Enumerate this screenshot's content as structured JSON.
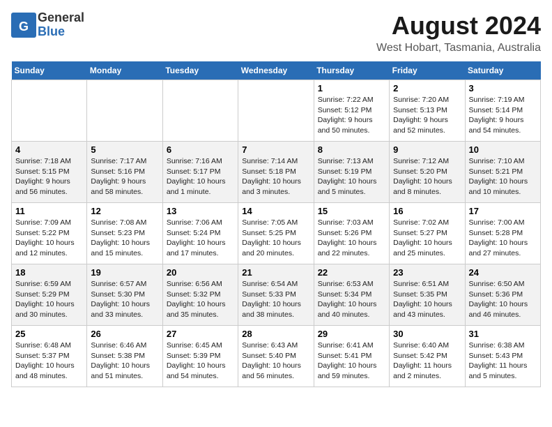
{
  "header": {
    "logo_general": "General",
    "logo_blue": "Blue",
    "month_title": "August 2024",
    "location": "West Hobart, Tasmania, Australia"
  },
  "weekdays": [
    "Sunday",
    "Monday",
    "Tuesday",
    "Wednesday",
    "Thursday",
    "Friday",
    "Saturday"
  ],
  "weeks": [
    [
      {
        "day": "",
        "content": ""
      },
      {
        "day": "",
        "content": ""
      },
      {
        "day": "",
        "content": ""
      },
      {
        "day": "",
        "content": ""
      },
      {
        "day": "1",
        "content": "Sunrise: 7:22 AM\nSunset: 5:12 PM\nDaylight: 9 hours\nand 50 minutes."
      },
      {
        "day": "2",
        "content": "Sunrise: 7:20 AM\nSunset: 5:13 PM\nDaylight: 9 hours\nand 52 minutes."
      },
      {
        "day": "3",
        "content": "Sunrise: 7:19 AM\nSunset: 5:14 PM\nDaylight: 9 hours\nand 54 minutes."
      }
    ],
    [
      {
        "day": "4",
        "content": "Sunrise: 7:18 AM\nSunset: 5:15 PM\nDaylight: 9 hours\nand 56 minutes."
      },
      {
        "day": "5",
        "content": "Sunrise: 7:17 AM\nSunset: 5:16 PM\nDaylight: 9 hours\nand 58 minutes."
      },
      {
        "day": "6",
        "content": "Sunrise: 7:16 AM\nSunset: 5:17 PM\nDaylight: 10 hours\nand 1 minute."
      },
      {
        "day": "7",
        "content": "Sunrise: 7:14 AM\nSunset: 5:18 PM\nDaylight: 10 hours\nand 3 minutes."
      },
      {
        "day": "8",
        "content": "Sunrise: 7:13 AM\nSunset: 5:19 PM\nDaylight: 10 hours\nand 5 minutes."
      },
      {
        "day": "9",
        "content": "Sunrise: 7:12 AM\nSunset: 5:20 PM\nDaylight: 10 hours\nand 8 minutes."
      },
      {
        "day": "10",
        "content": "Sunrise: 7:10 AM\nSunset: 5:21 PM\nDaylight: 10 hours\nand 10 minutes."
      }
    ],
    [
      {
        "day": "11",
        "content": "Sunrise: 7:09 AM\nSunset: 5:22 PM\nDaylight: 10 hours\nand 12 minutes."
      },
      {
        "day": "12",
        "content": "Sunrise: 7:08 AM\nSunset: 5:23 PM\nDaylight: 10 hours\nand 15 minutes."
      },
      {
        "day": "13",
        "content": "Sunrise: 7:06 AM\nSunset: 5:24 PM\nDaylight: 10 hours\nand 17 minutes."
      },
      {
        "day": "14",
        "content": "Sunrise: 7:05 AM\nSunset: 5:25 PM\nDaylight: 10 hours\nand 20 minutes."
      },
      {
        "day": "15",
        "content": "Sunrise: 7:03 AM\nSunset: 5:26 PM\nDaylight: 10 hours\nand 22 minutes."
      },
      {
        "day": "16",
        "content": "Sunrise: 7:02 AM\nSunset: 5:27 PM\nDaylight: 10 hours\nand 25 minutes."
      },
      {
        "day": "17",
        "content": "Sunrise: 7:00 AM\nSunset: 5:28 PM\nDaylight: 10 hours\nand 27 minutes."
      }
    ],
    [
      {
        "day": "18",
        "content": "Sunrise: 6:59 AM\nSunset: 5:29 PM\nDaylight: 10 hours\nand 30 minutes."
      },
      {
        "day": "19",
        "content": "Sunrise: 6:57 AM\nSunset: 5:30 PM\nDaylight: 10 hours\nand 33 minutes."
      },
      {
        "day": "20",
        "content": "Sunrise: 6:56 AM\nSunset: 5:32 PM\nDaylight: 10 hours\nand 35 minutes."
      },
      {
        "day": "21",
        "content": "Sunrise: 6:54 AM\nSunset: 5:33 PM\nDaylight: 10 hours\nand 38 minutes."
      },
      {
        "day": "22",
        "content": "Sunrise: 6:53 AM\nSunset: 5:34 PM\nDaylight: 10 hours\nand 40 minutes."
      },
      {
        "day": "23",
        "content": "Sunrise: 6:51 AM\nSunset: 5:35 PM\nDaylight: 10 hours\nand 43 minutes."
      },
      {
        "day": "24",
        "content": "Sunrise: 6:50 AM\nSunset: 5:36 PM\nDaylight: 10 hours\nand 46 minutes."
      }
    ],
    [
      {
        "day": "25",
        "content": "Sunrise: 6:48 AM\nSunset: 5:37 PM\nDaylight: 10 hours\nand 48 minutes."
      },
      {
        "day": "26",
        "content": "Sunrise: 6:46 AM\nSunset: 5:38 PM\nDaylight: 10 hours\nand 51 minutes."
      },
      {
        "day": "27",
        "content": "Sunrise: 6:45 AM\nSunset: 5:39 PM\nDaylight: 10 hours\nand 54 minutes."
      },
      {
        "day": "28",
        "content": "Sunrise: 6:43 AM\nSunset: 5:40 PM\nDaylight: 10 hours\nand 56 minutes."
      },
      {
        "day": "29",
        "content": "Sunrise: 6:41 AM\nSunset: 5:41 PM\nDaylight: 10 hours\nand 59 minutes."
      },
      {
        "day": "30",
        "content": "Sunrise: 6:40 AM\nSunset: 5:42 PM\nDaylight: 11 hours\nand 2 minutes."
      },
      {
        "day": "31",
        "content": "Sunrise: 6:38 AM\nSunset: 5:43 PM\nDaylight: 11 hours\nand 5 minutes."
      }
    ]
  ]
}
